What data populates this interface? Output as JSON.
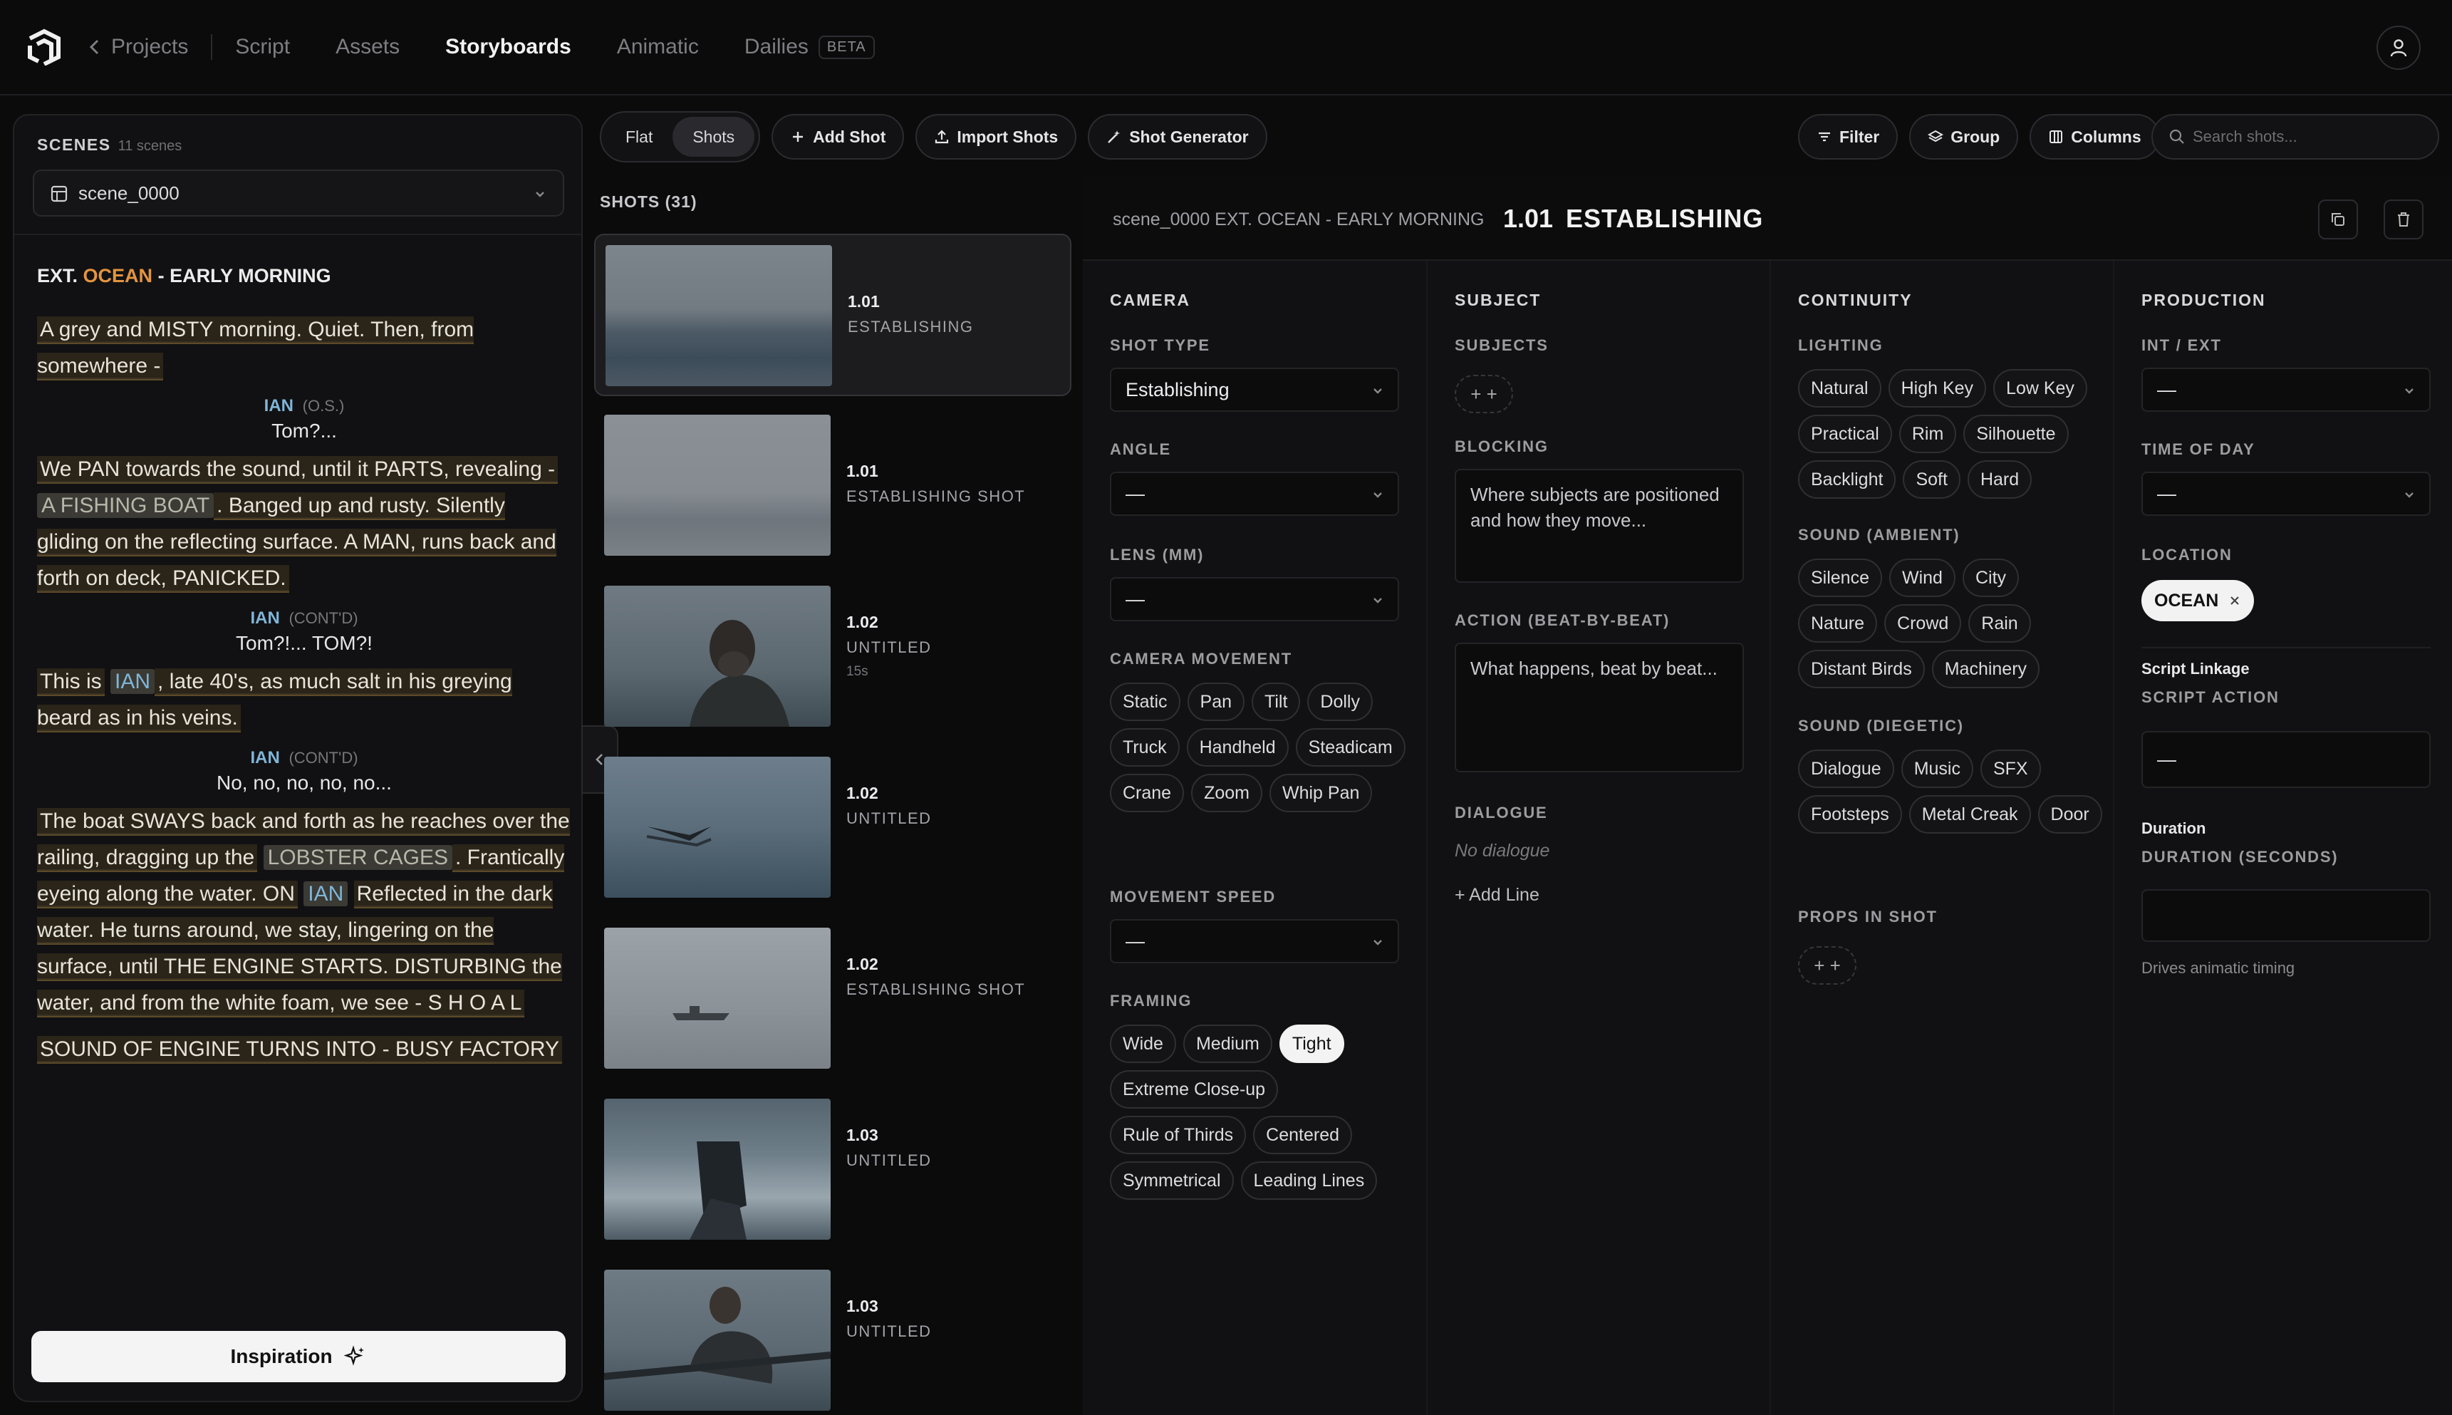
{
  "nav": {
    "back_label": "Projects",
    "items": [
      "Script",
      "Assets",
      "Storyboards",
      "Animatic",
      "Dailies"
    ],
    "active": "Storyboards",
    "beta_badge": "BETA"
  },
  "scenes": {
    "header": "SCENES",
    "count": "11 scenes",
    "selected": "scene_0000"
  },
  "script": {
    "slug_prefix": "EXT.",
    "slug_location": "OCEAN",
    "slug_suffix": "- EARLY MORNING",
    "p1": "A grey and MISTY morning. Quiet. Then, from somewhere -",
    "c1_name": "IAN",
    "c1_ext": "(O.S.)",
    "d1": "Tom?...",
    "p2a": "We PAN towards the sound, until it PARTS, revealing -",
    "p2_entity": "A FISHING BOAT",
    "p2b": ". Banged up and rusty. Silently gliding on the reflecting surface. A MAN, runs back and forth on deck, PANICKED.",
    "c2_name": "IAN",
    "c2_ext": "(CONT'D)",
    "d2": "Tom?!... TOM?!",
    "p3a": "This is",
    "p3_entity": "IAN",
    "p3b": ", late 40's, as much salt in his greying beard as in his veins.",
    "c3_name": "IAN",
    "c3_ext": "(CONT'D)",
    "d3": "No, no, no, no, no...",
    "p4a": "The boat SWAYS back and forth as he reaches over the railing, dragging up the",
    "p4_entity1": "LOBSTER CAGES",
    "p4b": ". Frantically eyeing along the water. ON",
    "p4_entity2": "IAN",
    "p4c": "Reflected in the dark water. He turns around, we stay, lingering on the surface, until THE ENGINE STARTS. DISTURBING the water, and from the white foam, we see - S H O A L",
    "p5": "SOUND OF ENGINE TURNS INTO - BUSY FACTORY"
  },
  "inspiration_label": "Inspiration",
  "toolbar": {
    "view_flat": "Flat",
    "view_shots": "Shots",
    "add_shot": "Add Shot",
    "import_shots": "Import Shots",
    "shot_generator": "Shot Generator",
    "filter": "Filter",
    "group": "Group",
    "columns": "Columns",
    "search_placeholder": "Search shots..."
  },
  "shots": {
    "header": "SHOTS (31)",
    "items": [
      {
        "num": "1.01",
        "label": "ESTABLISHING",
        "dur": ""
      },
      {
        "num": "1.01",
        "label": "ESTABLISHING SHOT",
        "dur": ""
      },
      {
        "num": "1.02",
        "label": "UNTITLED",
        "dur": "15s"
      },
      {
        "num": "1.02",
        "label": "UNTITLED",
        "dur": ""
      },
      {
        "num": "1.02",
        "label": "ESTABLISHING SHOT",
        "dur": ""
      },
      {
        "num": "1.03",
        "label": "UNTITLED",
        "dur": ""
      },
      {
        "num": "1.03",
        "label": "UNTITLED",
        "dur": ""
      }
    ]
  },
  "detail": {
    "path": "scene_0000 EXT. OCEAN - EARLY MORNING",
    "num": "1.01",
    "title": "ESTABLISHING",
    "camera": {
      "header": "CAMERA",
      "shot_type_label": "SHOT TYPE",
      "shot_type": "Establishing",
      "angle_label": "ANGLE",
      "angle": "—",
      "lens_label": "LENS (MM)",
      "lens": "—",
      "movement_label": "CAMERA MOVEMENT",
      "movements": [
        "Static",
        "Pan",
        "Tilt",
        "Dolly",
        "Truck",
        "Handheld",
        "Steadicam",
        "Crane",
        "Zoom",
        "Whip Pan"
      ],
      "speed_label": "MOVEMENT SPEED",
      "speed": "—",
      "framing_label": "FRAMING",
      "framing": [
        "Wide",
        "Medium",
        "Tight",
        "Extreme Close-up",
        "Rule of Thirds",
        "Centered",
        "Symmetrical",
        "Leading Lines"
      ],
      "framing_selected": "Tight"
    },
    "subject": {
      "header": "SUBJECT",
      "subjects_label": "SUBJECTS",
      "blocking_label": "BLOCKING",
      "blocking_placeholder": "Where subjects are positioned and how they move...",
      "action_label": "ACTION (BEAT-BY-BEAT)",
      "action_placeholder": "What happens, beat by beat...",
      "dialogue_label": "DIALOGUE",
      "no_dialogue": "No dialogue",
      "add_line": "Add Line"
    },
    "continuity": {
      "header": "CONTINUITY",
      "lighting_label": "LIGHTING",
      "lighting": [
        "Natural",
        "High Key",
        "Low Key",
        "Practical",
        "Rim",
        "Silhouette",
        "Backlight",
        "Soft",
        "Hard"
      ],
      "ambient_label": "SOUND (AMBIENT)",
      "ambient": [
        "Silence",
        "Wind",
        "City",
        "Nature",
        "Crowd",
        "Rain",
        "Distant Birds",
        "Machinery"
      ],
      "diegetic_label": "SOUND (DIEGETIC)",
      "diegetic": [
        "Dialogue",
        "Music",
        "SFX",
        "Footsteps",
        "Metal Creak",
        "Door"
      ],
      "props_label": "PROPS IN SHOT"
    },
    "production": {
      "header": "PRODUCTION",
      "intext_label": "INT / EXT",
      "intext": "—",
      "tod_label": "TIME OF DAY",
      "tod": "—",
      "location_label": "LOCATION",
      "location": "OCEAN",
      "linkage_label": "Script Linkage",
      "script_action_label": "SCRIPT ACTION",
      "script_action": "—",
      "duration_heading": "Duration",
      "duration_label": "DURATION (SECONDS)",
      "duration_hint": "Drives animatic timing"
    }
  },
  "colors": {
    "accent_location": "#e4943e",
    "character": "#7fb6d8",
    "bg": "#0b0b0c"
  }
}
